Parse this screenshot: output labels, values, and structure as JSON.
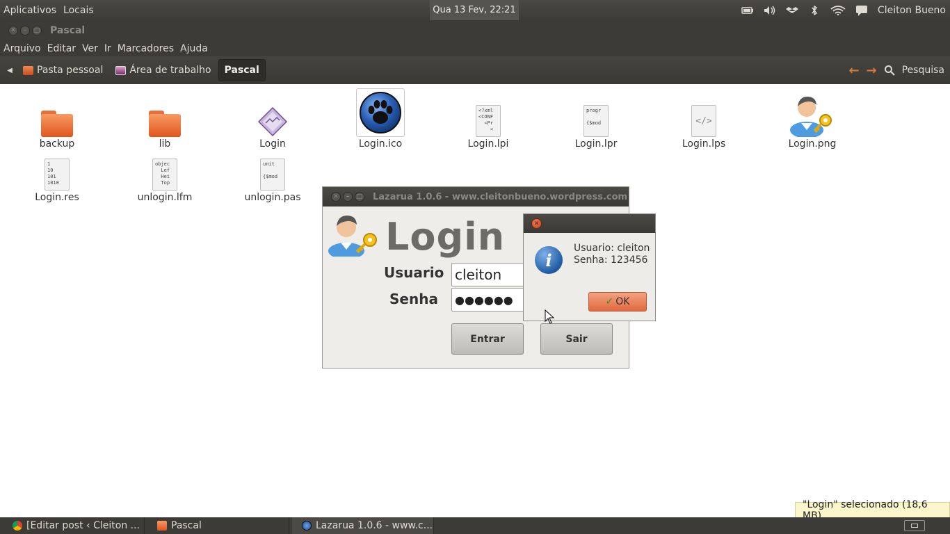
{
  "top_panel": {
    "menu": [
      "Aplicativos",
      "Locais"
    ],
    "clock": "Qua 13 Fev, 22:21",
    "user": "Cleiton Bueno"
  },
  "nautilus": {
    "window_title": "Pascal",
    "menu": [
      "Arquivo",
      "Editar",
      "Ver",
      "Ir",
      "Marcadores",
      "Ajuda"
    ],
    "breadcrumbs": [
      "Pasta pessoal",
      "Área de trabalho",
      "Pascal"
    ],
    "search_label": "Pesquisa",
    "files": [
      {
        "name": "backup",
        "type": "folder"
      },
      {
        "name": "lib",
        "type": "folder"
      },
      {
        "name": "Login",
        "type": "executable"
      },
      {
        "name": "Login.ico",
        "type": "ico"
      },
      {
        "name": "Login.lpi",
        "type": "doc",
        "preview": "<?xml\n<CONF\n  <Pr\n    <"
      },
      {
        "name": "Login.lpr",
        "type": "doc",
        "preview": "progr\n\n{$mod"
      },
      {
        "name": "Login.lps",
        "type": "code"
      },
      {
        "name": "Login.png",
        "type": "png"
      },
      {
        "name": "Login.res",
        "type": "doc",
        "preview": "1\n10\n101\n1010"
      },
      {
        "name": "unlogin.lfm",
        "type": "doc",
        "preview": "objec\n  Lef\n  Hei\n  Top"
      },
      {
        "name": "unlogin.pas",
        "type": "doc",
        "preview": "unit\n\n{$mod"
      }
    ],
    "status": "\"Login\" selecionado (18,6 MB)"
  },
  "lazarus_form": {
    "title": "Lazarua 1.0.6 - www.cleitonbueno.wordpress.com",
    "heading": "Login",
    "user_label": "Usuario",
    "user_value": "cleiton",
    "pass_label": "Senha",
    "pass_value": "●●●●●●",
    "enter_button": "Entrar",
    "exit_button": "Sair"
  },
  "message_dialog": {
    "line1": "Usuario: cleiton",
    "line2": "Senha: 123456",
    "ok_button": "OK"
  },
  "taskbar": {
    "tasks": [
      {
        "label": "[Editar post ‹ Cleiton ...",
        "color": "#e0a22d"
      },
      {
        "label": "Pascal",
        "color": "#e86e3a"
      },
      {
        "label": "Lazarua 1.0.6 - www.c...",
        "color": "#2a5fb6"
      }
    ]
  },
  "colors": {
    "panel": "#3c3b37",
    "accent": "#e0693f",
    "folder": "#e86e3a"
  }
}
